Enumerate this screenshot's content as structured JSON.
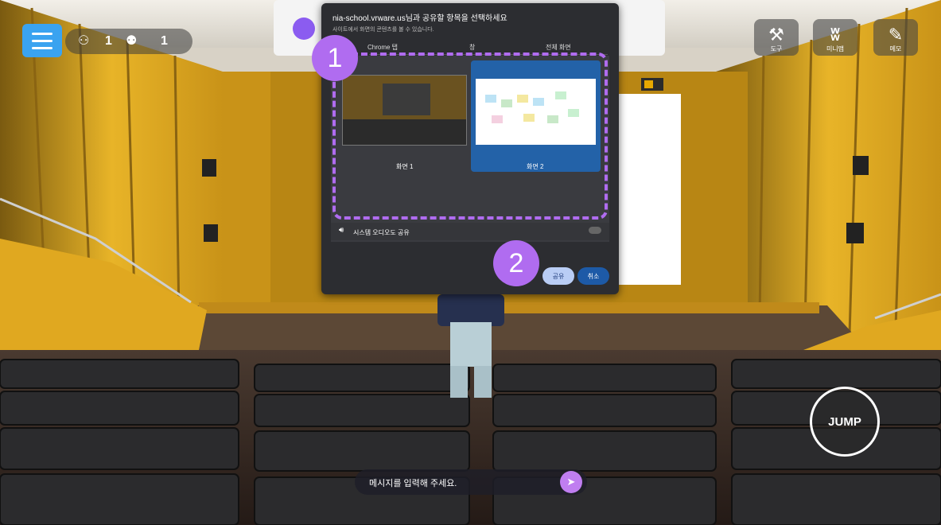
{
  "hud": {
    "user_count": "1",
    "group_count": "1",
    "tools": [
      {
        "label": "도구",
        "icon": "tools-icon"
      },
      {
        "label": "미니맵",
        "icon": "minimap-icon"
      },
      {
        "label": "메모",
        "icon": "memo-icon"
      }
    ]
  },
  "dialog": {
    "title": "nia-school.vrware.us님과 공유할 항목을 선택하세요",
    "subtitle": "사이트에서 화면의 콘텐츠를 볼 수 있습니다.",
    "tabs": [
      "Chrome 탭",
      "창",
      "전체 화면"
    ],
    "screens": [
      "화면 1",
      "화면 2"
    ],
    "audio_label": "시스템 오디오도 공유",
    "share_label": "공유",
    "cancel_label": "취소"
  },
  "steps": [
    "1",
    "2"
  ],
  "chat": {
    "placeholder": "메시지를 입력해 주세요."
  },
  "jump_label": "JUMP",
  "colors": {
    "accent": "#b06cf0",
    "menu": "#3aa3f0",
    "wall": "#e8b428"
  }
}
